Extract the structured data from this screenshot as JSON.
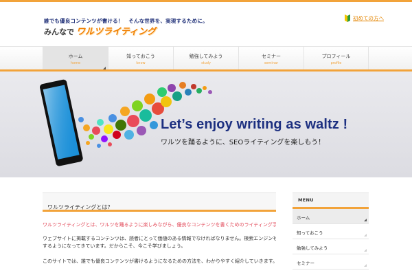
{
  "header": {
    "tagline": "誰でも優良コンテンツが書ける！　そんな世界を、実現するために。",
    "logo_prefix": "みんなで",
    "logo_main": "ワルツライティング",
    "beginner_link": "初めての方へ"
  },
  "nav": {
    "items": [
      {
        "label": "ホーム",
        "sub": "home"
      },
      {
        "label": "知っておこう",
        "sub": "know"
      },
      {
        "label": "勉強してみよう",
        "sub": "study"
      },
      {
        "label": "セミナー",
        "sub": "seminar"
      },
      {
        "label": "プロフィール",
        "sub": "profile"
      }
    ]
  },
  "hero": {
    "title": "Let’s enjoy writing as waltz !",
    "subtitle": "ワルツを踊るように、SEOライティングを楽しもう！"
  },
  "main": {
    "heading": "ワルツライティングとは？",
    "para1": "ワルツライティングとは、ワルツを踊るように楽しみながら、優良なコンテンツを書くためのライティング手法です。",
    "para2_lines": [
      "ウェブサイトに掲載するコンテンツは、読者にとって価値のある情報でなければなりません。検索エンジンもまた、読者のための良質なコンテンツを高く評価",
      "するようになってきています。だからこそ、今こそ学びましょう。"
    ],
    "para3": "このサイトでは、誰でも優良コンテンツが書けるようになるための方法を、わかりやすく紹介していきます。"
  },
  "sidebar": {
    "title": "MENU",
    "items": [
      {
        "label": "ホーム"
      },
      {
        "label": "知っておこう"
      },
      {
        "label": "勉強してみよう"
      },
      {
        "label": "セミナー"
      }
    ]
  },
  "colors": {
    "accent": "#f2a33a",
    "title_blue": "#1c2f80",
    "red_text": "#e24a5a"
  }
}
